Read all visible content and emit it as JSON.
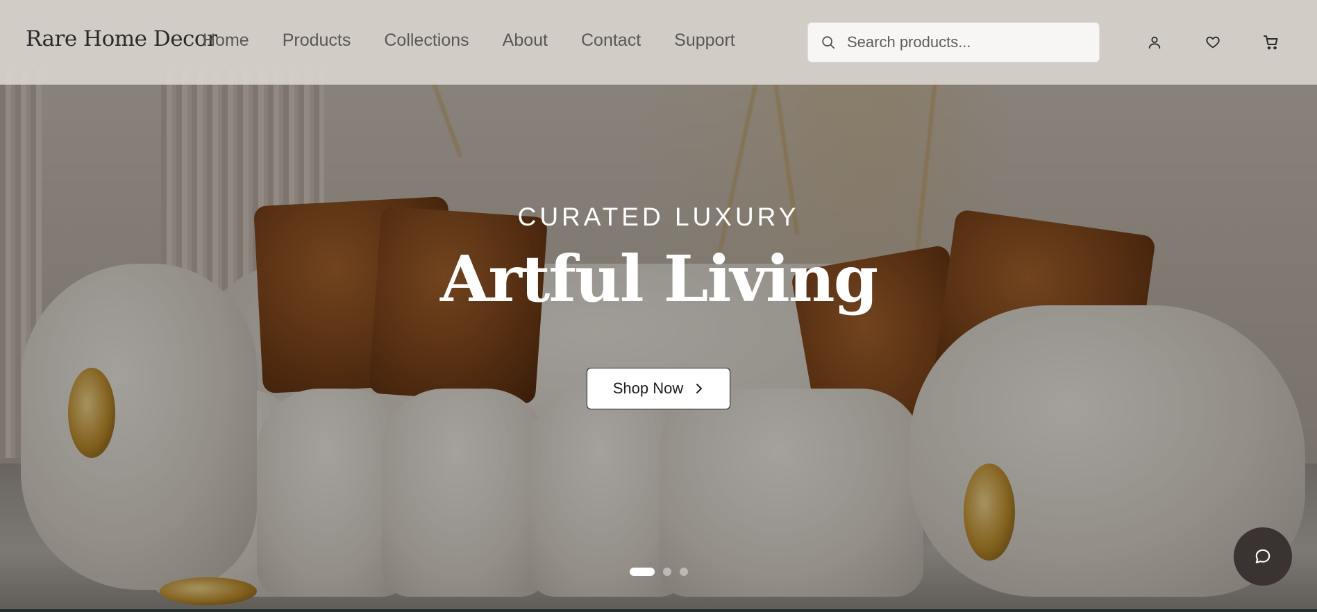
{
  "brand": {
    "logo_text": "Rare Home Decor"
  },
  "nav": {
    "items": [
      {
        "label": "Home"
      },
      {
        "label": "Products"
      },
      {
        "label": "Collections"
      },
      {
        "label": "About"
      },
      {
        "label": "Contact"
      },
      {
        "label": "Support"
      }
    ]
  },
  "search": {
    "placeholder": "Search products...",
    "value": "",
    "icon": "search-icon"
  },
  "header_icons": [
    "user-icon",
    "heart-icon",
    "cart-icon"
  ],
  "hero": {
    "eyebrow": "CURATED LUXURY",
    "headline": "Artful Living",
    "cta_label": "Shop Now",
    "slides_total": 3,
    "active_slide": 1
  },
  "chat": {
    "icon": "chat-icon"
  },
  "colors": {
    "header_bg": "#d7d2cc",
    "text_dark": "#2c2a28",
    "nav_text": "#5a5753",
    "chat_bg": "#3a3331",
    "accent_white": "#ffffff"
  }
}
